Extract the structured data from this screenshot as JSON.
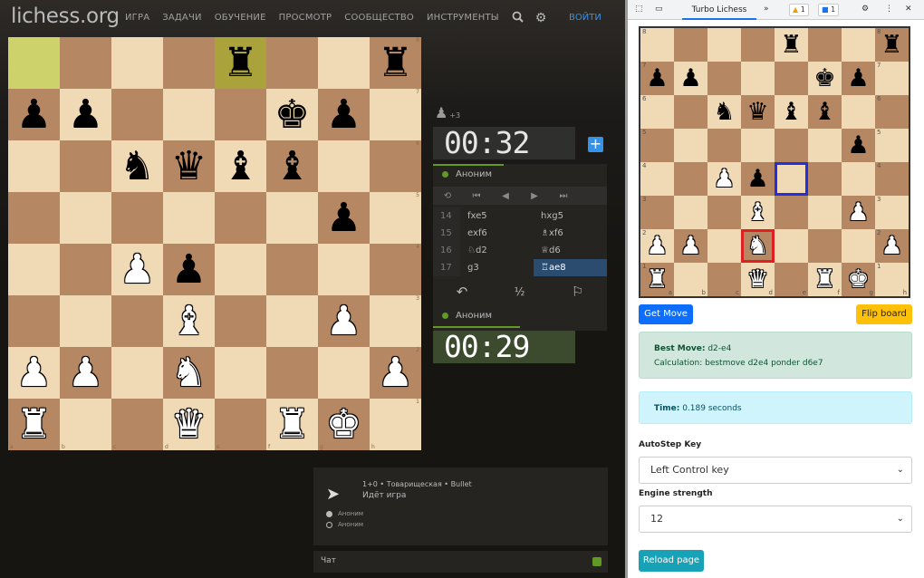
{
  "lichess": {
    "logo": "lichess.org",
    "nav": [
      "ИГРА",
      "ЗАДАЧИ",
      "ОБУЧЕНИЕ",
      "ПРОСМОТР",
      "СООБЩЕСТВО",
      "ИНСТРУМЕНТЫ"
    ],
    "login": "ВОЙТИ",
    "ranks": [
      "8",
      "7",
      "6",
      "5",
      "4",
      "3",
      "2",
      "1"
    ],
    "files": [
      "a",
      "b",
      "c",
      "d",
      "e",
      "f",
      "g",
      "h"
    ],
    "board": [
      [
        "",
        "",
        "",
        "",
        "bR",
        "",
        "",
        "bR"
      ],
      [
        "bP",
        "bP",
        "",
        "",
        "",
        "bK",
        "bP",
        ""
      ],
      [
        "",
        "",
        "bN",
        "bQ",
        "bB",
        "bB",
        "",
        ""
      ],
      [
        "",
        "",
        "",
        "",
        "",
        "",
        "bP",
        ""
      ],
      [
        "",
        "",
        "wP",
        "bP",
        "",
        "",
        "",
        ""
      ],
      [
        "",
        "",
        "",
        "wB",
        "",
        "",
        "wP",
        ""
      ],
      [
        "wP",
        "wP",
        "",
        "wN",
        "",
        "",
        "",
        "wP"
      ],
      [
        "wR",
        "",
        "",
        "wQ",
        "",
        "wR",
        "wK",
        ""
      ]
    ],
    "pocket": {
      "piece": "♟",
      "diff": "+3"
    },
    "clock_top": "00:32",
    "clock_bottom": "00:29",
    "player_top": "Аноним",
    "player_bottom": "Аноним",
    "moves": [
      {
        "no": "14",
        "w": "fxe5",
        "b": "hxg5"
      },
      {
        "no": "15",
        "w": "exf6",
        "b": "♗xf6"
      },
      {
        "no": "16",
        "w": "♘d2",
        "b": "♕d6"
      },
      {
        "no": "17",
        "w": "g3",
        "b": "♖ae8"
      }
    ],
    "game_title": "1+0 • Товарищеская • Bullet",
    "game_status": "Идёт игра",
    "game_players": [
      "Аноним",
      "Аноним"
    ],
    "chat": "Чат"
  },
  "devtools": {
    "tab": "Turbo Lichess",
    "more": "»",
    "warnings": "1",
    "messages": "1"
  },
  "extension": {
    "ranks": [
      "8",
      "7",
      "6",
      "5",
      "4",
      "3",
      "2",
      "1"
    ],
    "files": [
      "a",
      "b",
      "c",
      "d",
      "e",
      "f",
      "g",
      "h"
    ],
    "board": [
      [
        "",
        "",
        "",
        "",
        "bR",
        "",
        "",
        "bR"
      ],
      [
        "bP",
        "bP",
        "",
        "",
        "",
        "bK",
        "bP",
        ""
      ],
      [
        "",
        "",
        "bN",
        "bQ",
        "bB",
        "bB",
        "",
        ""
      ],
      [
        "",
        "",
        "",
        "",
        "",
        "",
        "bP",
        ""
      ],
      [
        "",
        "",
        "wP",
        "bP",
        "",
        "",
        "",
        ""
      ],
      [
        "",
        "",
        "",
        "wB",
        "",
        "",
        "wP",
        ""
      ],
      [
        "wP",
        "wP",
        "",
        "wN",
        "",
        "",
        "",
        "wP"
      ],
      [
        "wR",
        "",
        "",
        "wQ",
        "",
        "wR",
        "wK",
        ""
      ]
    ],
    "get_move": "Get Move",
    "flip_board": "Flip board",
    "best_move_label": "Best Move:",
    "best_move": "d2-e4",
    "calculation": "Calculation: bestmove d2e4 ponder d6e7",
    "time_label": "Time:",
    "time": "0.189 seconds",
    "autostep_label": "AutoStep Key",
    "autostep_value": "Left Control key",
    "strength_label": "Engine strength",
    "strength_value": "12",
    "reload": "Reload page"
  }
}
